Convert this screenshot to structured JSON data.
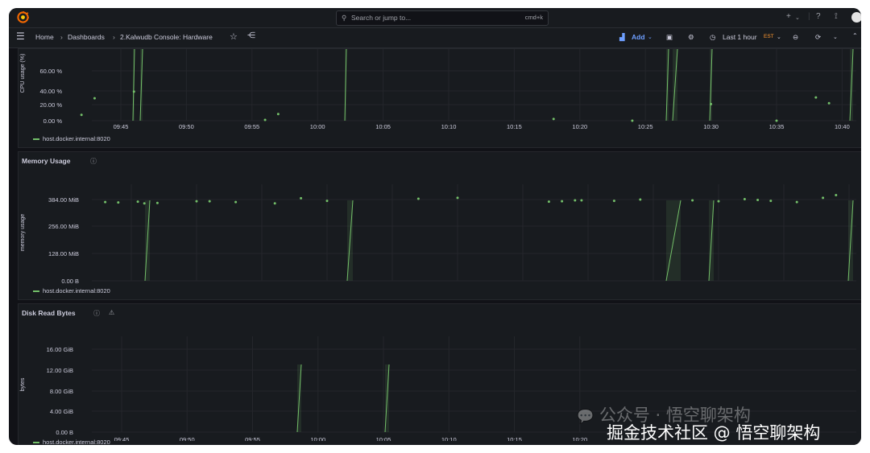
{
  "topbar": {
    "search_placeholder": "Search or jump to...",
    "search_shortcut": "cmd+k"
  },
  "breadcrumb": {
    "home": "Home",
    "dashboards": "Dashboards",
    "current": "2.Kalwudb Console: Hardware"
  },
  "toolbar": {
    "add_label": "Add",
    "time_range": "Last 1 hour",
    "timezone": "EST"
  },
  "colors": {
    "series": "#73bf69",
    "background": "#111217",
    "panel": "#181b1f",
    "timezone": "#ff9830"
  },
  "panels": [
    {
      "title": "",
      "legend": "host.docker.internal:8020"
    },
    {
      "title": "Memory Usage",
      "legend": "host.docker.internal:8020"
    },
    {
      "title": "Disk Read Bytes",
      "legend": "host.docker.internal:8020"
    }
  ],
  "watermark": {
    "line1": "公众号 · 悟空聊架构",
    "line2": "掘金技术社区 @ 悟空聊架构"
  },
  "chart_data": [
    {
      "type": "scatter",
      "title": "",
      "ylabel": "CPU usage (%)",
      "xticks": [
        "09:45",
        "09:50",
        "09:55",
        "10:00",
        "10:05",
        "10:10",
        "10:15",
        "10:20",
        "10:25",
        "10:30",
        "10:35",
        "10:40"
      ],
      "yticks": [
        "0.00 %",
        "20.00 %",
        "40.00 %",
        "60.00 %"
      ],
      "ylim": [
        0,
        70
      ],
      "series": [
        {
          "name": "host.docker.internal:8020",
          "x": [
            "09:42",
            "09:43",
            "09:46",
            "09:56",
            "09:57",
            "10:18",
            "10:24",
            "10:30",
            "10:35",
            "10:38",
            "10:39"
          ],
          "values": [
            7,
            27,
            35,
            1,
            8,
            2,
            0,
            20,
            0,
            28,
            21
          ]
        }
      ]
    },
    {
      "type": "scatter",
      "title": "Memory Usage",
      "ylabel": "memory usage",
      "xticks": [
        "09:45",
        "09:50",
        "09:55",
        "10:00",
        "10:05",
        "10:10",
        "10:15",
        "10:20",
        "10:25",
        "10:30",
        "10:35",
        "10:40"
      ],
      "yticks": [
        "0.00 B",
        "128.00 MiB",
        "256.00 MiB",
        "384.00 MiB"
      ],
      "ylim": [
        0,
        420
      ],
      "series": [
        {
          "name": "host.docker.internal:8020",
          "x": [
            "09:43",
            "09:44",
            "09:44.5",
            "09:46",
            "09:47",
            "09:50",
            "09:51",
            "09:53",
            "09:56",
            "09:58",
            "10:00",
            "10:07",
            "10:10",
            "10:17",
            "10:18",
            "10:18.5",
            "10:19",
            "10:22",
            "10:24",
            "10:28",
            "10:30",
            "10:32",
            "10:33",
            "10:34",
            "10:36",
            "10:38",
            "10:39"
          ],
          "values": [
            372,
            370,
            374,
            366,
            368,
            376,
            376,
            372,
            366,
            390,
            378,
            388,
            392,
            374,
            376,
            380,
            380,
            378,
            384,
            380,
            376,
            386,
            382,
            378,
            372,
            392,
            405
          ]
        }
      ]
    },
    {
      "type": "line",
      "title": "Disk Read Bytes",
      "ylabel": "bytes",
      "xticks": [
        "09:45",
        "09:50",
        "09:55",
        "10:00",
        "10:05",
        "10:10",
        "10:15",
        "10:20"
      ],
      "yticks": [
        "0.00 B",
        "4.00 GiB",
        "8.00 GiB",
        "12.00 GiB",
        "16.00 GiB"
      ],
      "ylim": [
        0,
        18
      ],
      "series": [
        {
          "name": "host.docker.internal:8020"
        }
      ]
    }
  ]
}
